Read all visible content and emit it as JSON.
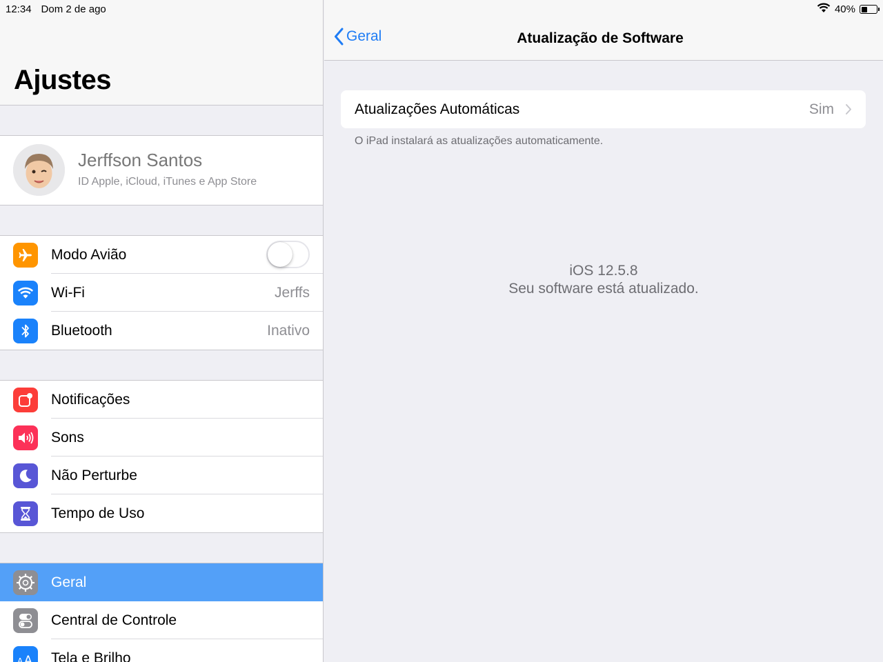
{
  "status_bar": {
    "time": "12:34",
    "date": "Dom 2 de ago",
    "battery": "40%",
    "battery_level": 0.4
  },
  "sidebar": {
    "title": "Ajustes",
    "profile": {
      "name": "Jerffson Santos",
      "subtitle": "ID Apple, iCloud, iTunes e App Store"
    },
    "connectivity": [
      {
        "label": "Modo Avião",
        "icon": "airplane-icon",
        "color": "#ff9500",
        "toggle": false
      },
      {
        "label": "Wi-Fi",
        "icon": "wifi-icon",
        "color": "#1a82fb",
        "value": "Jerffs"
      },
      {
        "label": "Bluetooth",
        "icon": "bluetooth-icon",
        "color": "#1a82fb",
        "value": "Inativo"
      }
    ],
    "notifications": [
      {
        "label": "Notificações",
        "icon": "notifications-icon",
        "color": "#fc3d39"
      },
      {
        "label": "Sons",
        "icon": "speaker-icon",
        "color": "#fc3158"
      },
      {
        "label": "Não Perturbe",
        "icon": "moon-icon",
        "color": "#5856d6"
      },
      {
        "label": "Tempo de Uso",
        "icon": "hourglass-icon",
        "color": "#5856d6"
      }
    ],
    "general": [
      {
        "label": "Geral",
        "icon": "gear-icon",
        "color": "#8e8e93",
        "selected": true
      },
      {
        "label": "Central de Controle",
        "icon": "switches-icon",
        "color": "#8e8e93"
      },
      {
        "label": "Tela e Brilho",
        "icon": "text-size-icon",
        "color": "#1a82fb"
      }
    ]
  },
  "detail": {
    "back_label": "Geral",
    "title": "Atualização de Software",
    "auto_updates": {
      "label": "Atualizações Automáticas",
      "value": "Sim"
    },
    "footnote": "O iPad instalará as atualizações automaticamente.",
    "version": "iOS 12.5.8",
    "status": "Seu software está atualizado."
  }
}
